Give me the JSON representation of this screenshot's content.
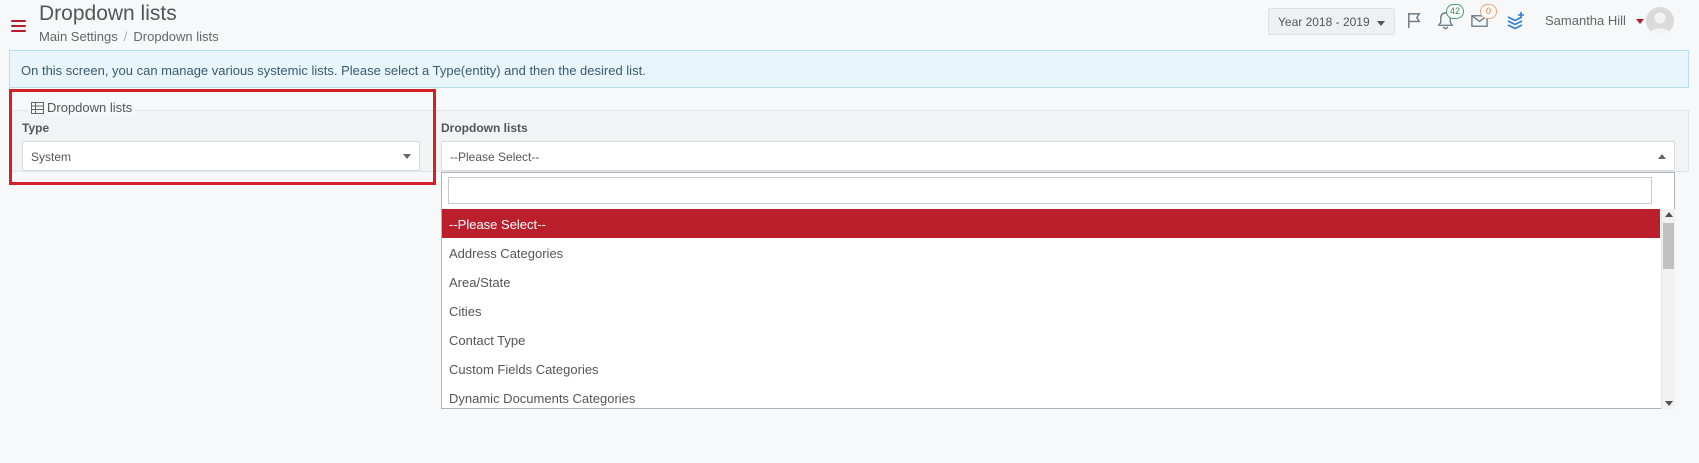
{
  "header": {
    "title": "Dropdown lists",
    "breadcrumb": [
      "Main Settings",
      "Dropdown lists"
    ],
    "year_selector": "Year 2018 - 2019",
    "notifications_count": "42",
    "messages_count": "0",
    "user_name": "Samantha Hill"
  },
  "info_message": "On this screen, you can manage various systemic lists. Please select a Type(entity) and then the desired list.",
  "filters": {
    "legend": "Dropdown lists",
    "type_label": "Type",
    "type_value": "System",
    "list_label": "Dropdown lists",
    "list_value": "--Please Select--"
  },
  "dropdown": {
    "search_value": "",
    "options": [
      "--Please Select--",
      "Address Categories",
      "Area/State",
      "Cities",
      "Contact Type",
      "Custom Fields Categories",
      "Dynamic Documents Categories"
    ],
    "selected_index": 0
  },
  "colors": {
    "accent": "#bb1f2c",
    "highlight_border": "#d42027",
    "info_bg": "#e8f5fb"
  }
}
